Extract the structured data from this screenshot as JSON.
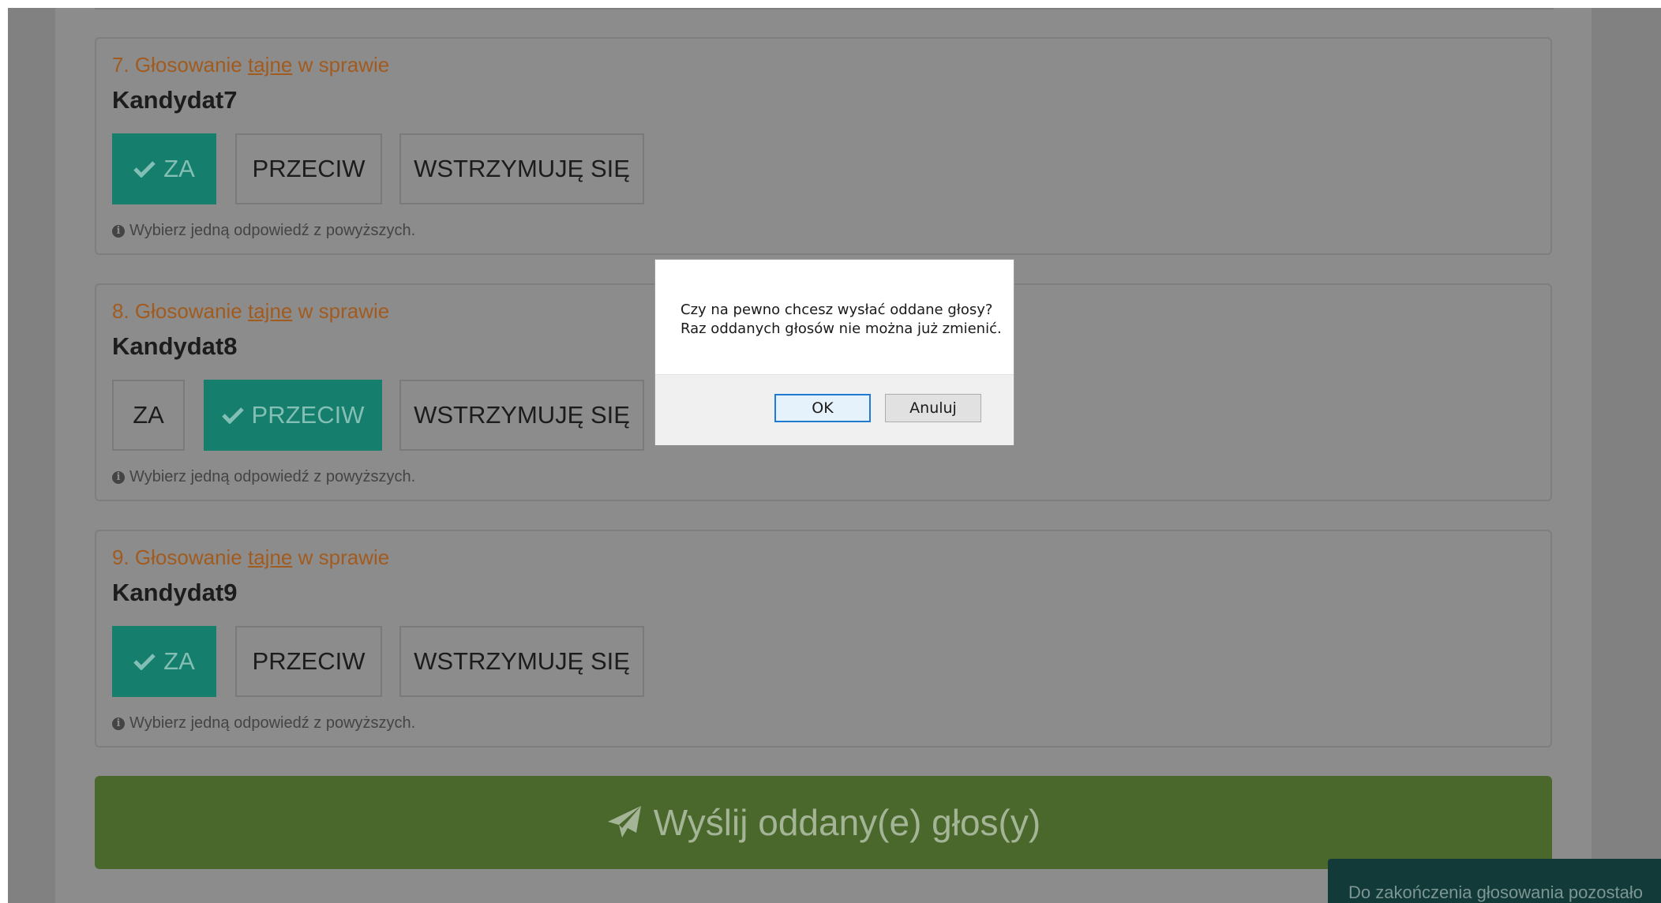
{
  "ballots": [
    {
      "heading_prefix": "7. Głosowanie",
      "heading_secret": "tajne",
      "heading_suffix": "w sprawie",
      "candidate": "Kandydat7",
      "options": [
        "ZA",
        "PRZECIW",
        "WSTRZYMUJĘ SIĘ"
      ],
      "selected": "ZA",
      "hint": "Wybierz jedną odpowiedź z powyższych."
    },
    {
      "heading_prefix": "8. Głosowanie",
      "heading_secret": "tajne",
      "heading_suffix": "w sprawie",
      "candidate": "Kandydat8",
      "options": [
        "ZA",
        "PRZECIW",
        "WSTRZYMUJĘ SIĘ"
      ],
      "selected": "PRZECIW",
      "hint": "Wybierz jedną odpowiedź z powyższych."
    },
    {
      "heading_prefix": "9. Głosowanie",
      "heading_secret": "tajne",
      "heading_suffix": "w sprawie",
      "candidate": "Kandydat9",
      "options": [
        "ZA",
        "PRZECIW",
        "WSTRZYMUJĘ SIĘ"
      ],
      "selected": "ZA",
      "hint": "Wybierz jedną odpowiedź z powyższych."
    }
  ],
  "submit": {
    "label": "Wyślij oddany(e) głos(y)",
    "icon": "paper-plane-icon"
  },
  "timer": {
    "text": "Do zakończenia głosowania pozostało"
  },
  "dialog": {
    "message_line1": "Czy na pewno chcesz wysłać oddane głosy?",
    "message_line2": "Raz oddanych głosów nie można już zmienić.",
    "ok_label": "OK",
    "cancel_label": "Anuluj"
  },
  "colors": {
    "selected": "#157e6c",
    "submit": "#4b682c",
    "heading": "#a25b1e",
    "dialog_ok_border": "#1e7ad2"
  }
}
